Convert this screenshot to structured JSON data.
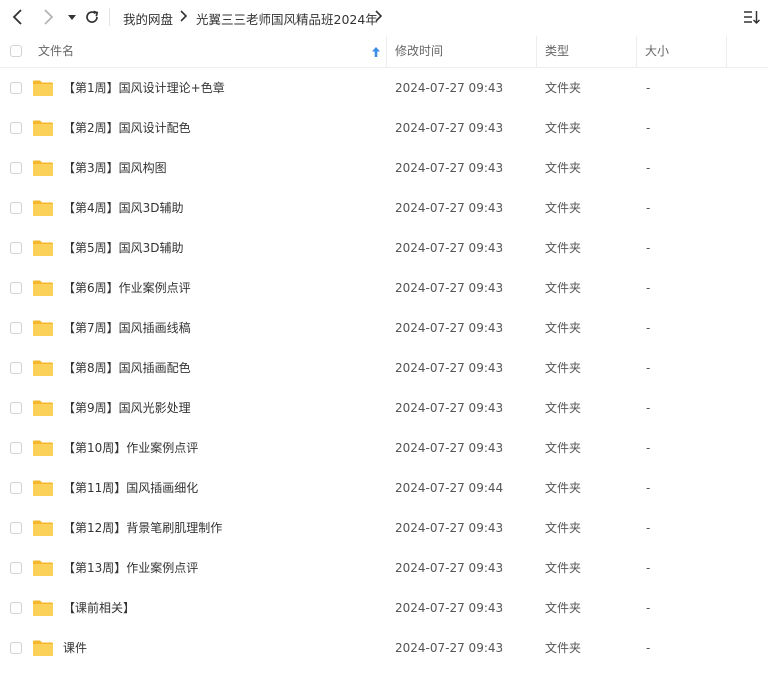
{
  "breadcrumb": {
    "root": "我的网盘",
    "current": "光翼三三老师国风精品班2024年"
  },
  "columns": {
    "name": "文件名",
    "modified": "修改时间",
    "type": "类型",
    "size": "大小"
  },
  "icons": {
    "back": "chevron-left-icon",
    "forward": "chevron-right-icon",
    "history": "caret-down-icon",
    "refresh": "refresh-icon",
    "sort": "sort-icon",
    "sort_direction": "arrow-up-icon",
    "folder": "folder-icon"
  },
  "colors": {
    "folder": "#f7c544",
    "sort_arrow": "#3a8ee6"
  },
  "files": [
    {
      "name": "【第1周】国风设计理论+色章",
      "modified": "2024-07-27 09:43",
      "type": "文件夹",
      "size": "-"
    },
    {
      "name": "【第2周】国风设计配色",
      "modified": "2024-07-27 09:43",
      "type": "文件夹",
      "size": "-"
    },
    {
      "name": "【第3周】国风构图",
      "modified": "2024-07-27 09:43",
      "type": "文件夹",
      "size": "-"
    },
    {
      "name": "【第4周】国风3D辅助",
      "modified": "2024-07-27 09:43",
      "type": "文件夹",
      "size": "-"
    },
    {
      "name": "【第5周】国风3D辅助",
      "modified": "2024-07-27 09:43",
      "type": "文件夹",
      "size": "-"
    },
    {
      "name": "【第6周】作业案例点评",
      "modified": "2024-07-27 09:43",
      "type": "文件夹",
      "size": "-"
    },
    {
      "name": "【第7周】国风插画线稿",
      "modified": "2024-07-27 09:43",
      "type": "文件夹",
      "size": "-"
    },
    {
      "name": "【第8周】国风插画配色",
      "modified": "2024-07-27 09:43",
      "type": "文件夹",
      "size": "-"
    },
    {
      "name": "【第9周】国风光影处理",
      "modified": "2024-07-27 09:43",
      "type": "文件夹",
      "size": "-"
    },
    {
      "name": "【第10周】作业案例点评",
      "modified": "2024-07-27 09:43",
      "type": "文件夹",
      "size": "-"
    },
    {
      "name": "【第11周】国风插画细化",
      "modified": "2024-07-27 09:44",
      "type": "文件夹",
      "size": "-"
    },
    {
      "name": "【第12周】背景笔刷肌理制作",
      "modified": "2024-07-27 09:43",
      "type": "文件夹",
      "size": "-"
    },
    {
      "name": "【第13周】作业案例点评",
      "modified": "2024-07-27 09:43",
      "type": "文件夹",
      "size": "-"
    },
    {
      "name": "【课前相关】",
      "modified": "2024-07-27 09:43",
      "type": "文件夹",
      "size": "-"
    },
    {
      "name": "课件",
      "modified": "2024-07-27 09:43",
      "type": "文件夹",
      "size": "-"
    }
  ]
}
